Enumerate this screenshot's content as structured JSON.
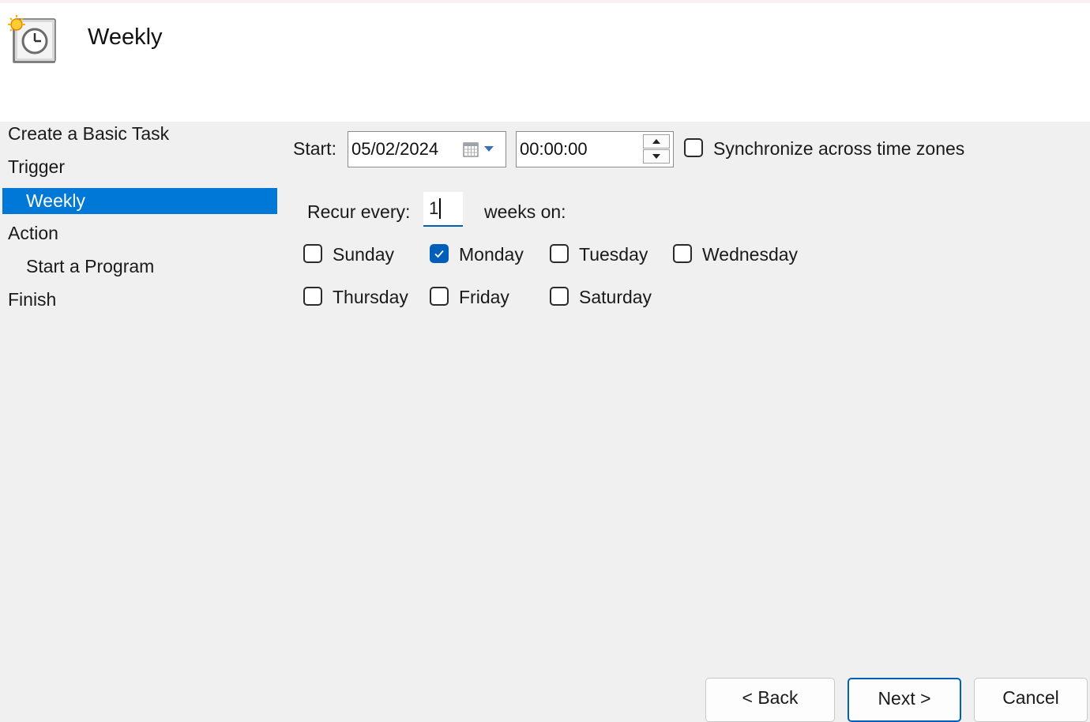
{
  "header": {
    "title": "Weekly",
    "icon": "task-scheduler-clock-icon"
  },
  "nav": {
    "items": [
      {
        "label": "Create a Basic Task"
      },
      {
        "label": "Trigger"
      },
      {
        "label": "Weekly"
      },
      {
        "label": "Action"
      },
      {
        "label": "Start a Program"
      },
      {
        "label": "Finish"
      }
    ],
    "selected": "Weekly"
  },
  "start": {
    "label": "Start:",
    "date": "05/02/2024",
    "time": "00:00:00",
    "calendar_icon": "calendar-icon",
    "sync_label": "Synchronize across time zones",
    "sync_checked": false
  },
  "recur": {
    "label": "Recur every:",
    "value": "1",
    "suffix": "weeks on:"
  },
  "days": [
    {
      "label": "Sunday",
      "checked": false
    },
    {
      "label": "Monday",
      "checked": true
    },
    {
      "label": "Tuesday",
      "checked": false
    },
    {
      "label": "Wednesday",
      "checked": false
    },
    {
      "label": "Thursday",
      "checked": false
    },
    {
      "label": "Friday",
      "checked": false
    },
    {
      "label": "Saturday",
      "checked": false
    }
  ],
  "buttons": {
    "back": "< Back",
    "next": "Next >",
    "cancel": "Cancel"
  },
  "colors": {
    "accent": "#005fb8",
    "selection": "#0078d7",
    "background": "#f0f0f0"
  }
}
